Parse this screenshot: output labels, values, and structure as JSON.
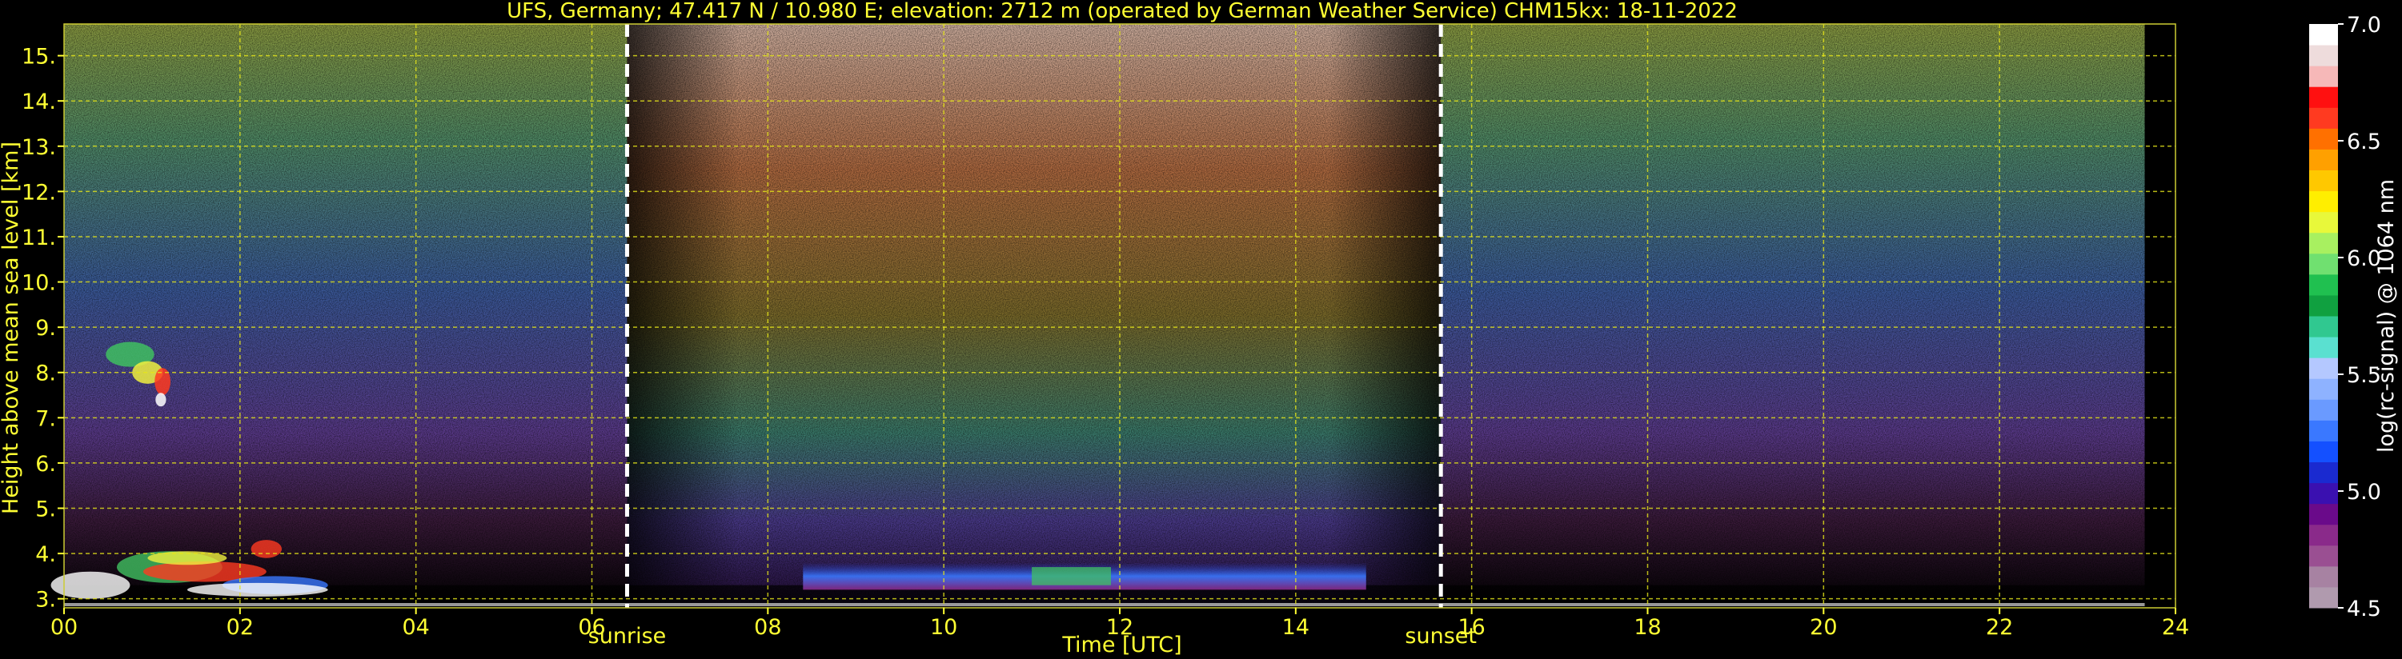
{
  "chart_data": {
    "type": "heatmap",
    "title": "UFS, Germany; 47.417 N / 10.980 E; elevation: 2712 m  (operated by German Weather Service)    CHM15kx: 18-11-2022",
    "xlabel": "Time [UTC]",
    "ylabel": "Height above mean sea level [km]",
    "xlim": [
      0,
      24
    ],
    "ylim": [
      2.8,
      15.7
    ],
    "x_ticks": [
      0,
      2,
      4,
      6,
      8,
      10,
      12,
      14,
      16,
      18,
      20,
      22,
      24
    ],
    "x_tick_labels": [
      "00",
      "02",
      "04",
      "06",
      "08",
      "10",
      "12",
      "14",
      "16",
      "18",
      "20",
      "22",
      "24"
    ],
    "y_ticks": [
      3,
      4,
      5,
      6,
      7,
      8,
      9,
      10,
      11,
      12,
      13,
      14,
      15
    ],
    "y_tick_labels": [
      "3.",
      "4.",
      "5.",
      "6.",
      "7.",
      "8.",
      "9.",
      "10.",
      "11.",
      "12.",
      "13.",
      "14.",
      "15."
    ],
    "grid": true,
    "markers": [
      {
        "label": "sunrise",
        "time": 6.4
      },
      {
        "label": "sunset",
        "time": 15.65
      }
    ],
    "colorbar": {
      "label": "log(rc-signal) @ 1064 nm",
      "range": [
        4.5,
        7.0
      ],
      "tick_values": [
        4.5,
        5.0,
        5.5,
        6.0,
        6.5,
        7.0
      ],
      "tick_labels": [
        "4.5",
        "5.0",
        "5.5",
        "6.0",
        "6.5",
        "7.0"
      ],
      "colors": [
        "#b09aae",
        "#a782a2",
        "#9a4f92",
        "#8a2a8a",
        "#6a0a8a",
        "#3a10b0",
        "#1a2ad0",
        "#1450ff",
        "#3a78ff",
        "#6a9aff",
        "#8eb2ff",
        "#b4c8ff",
        "#5ae0d0",
        "#30c890",
        "#10a040",
        "#20c050",
        "#70e070",
        "#a8f060",
        "#e8f83a",
        "#ffee00",
        "#ffc800",
        "#ffa000",
        "#ff7000",
        "#ff3a20",
        "#ff1010",
        "#f6b8b8",
        "#eedcdc",
        "#ffffff"
      ]
    }
  }
}
